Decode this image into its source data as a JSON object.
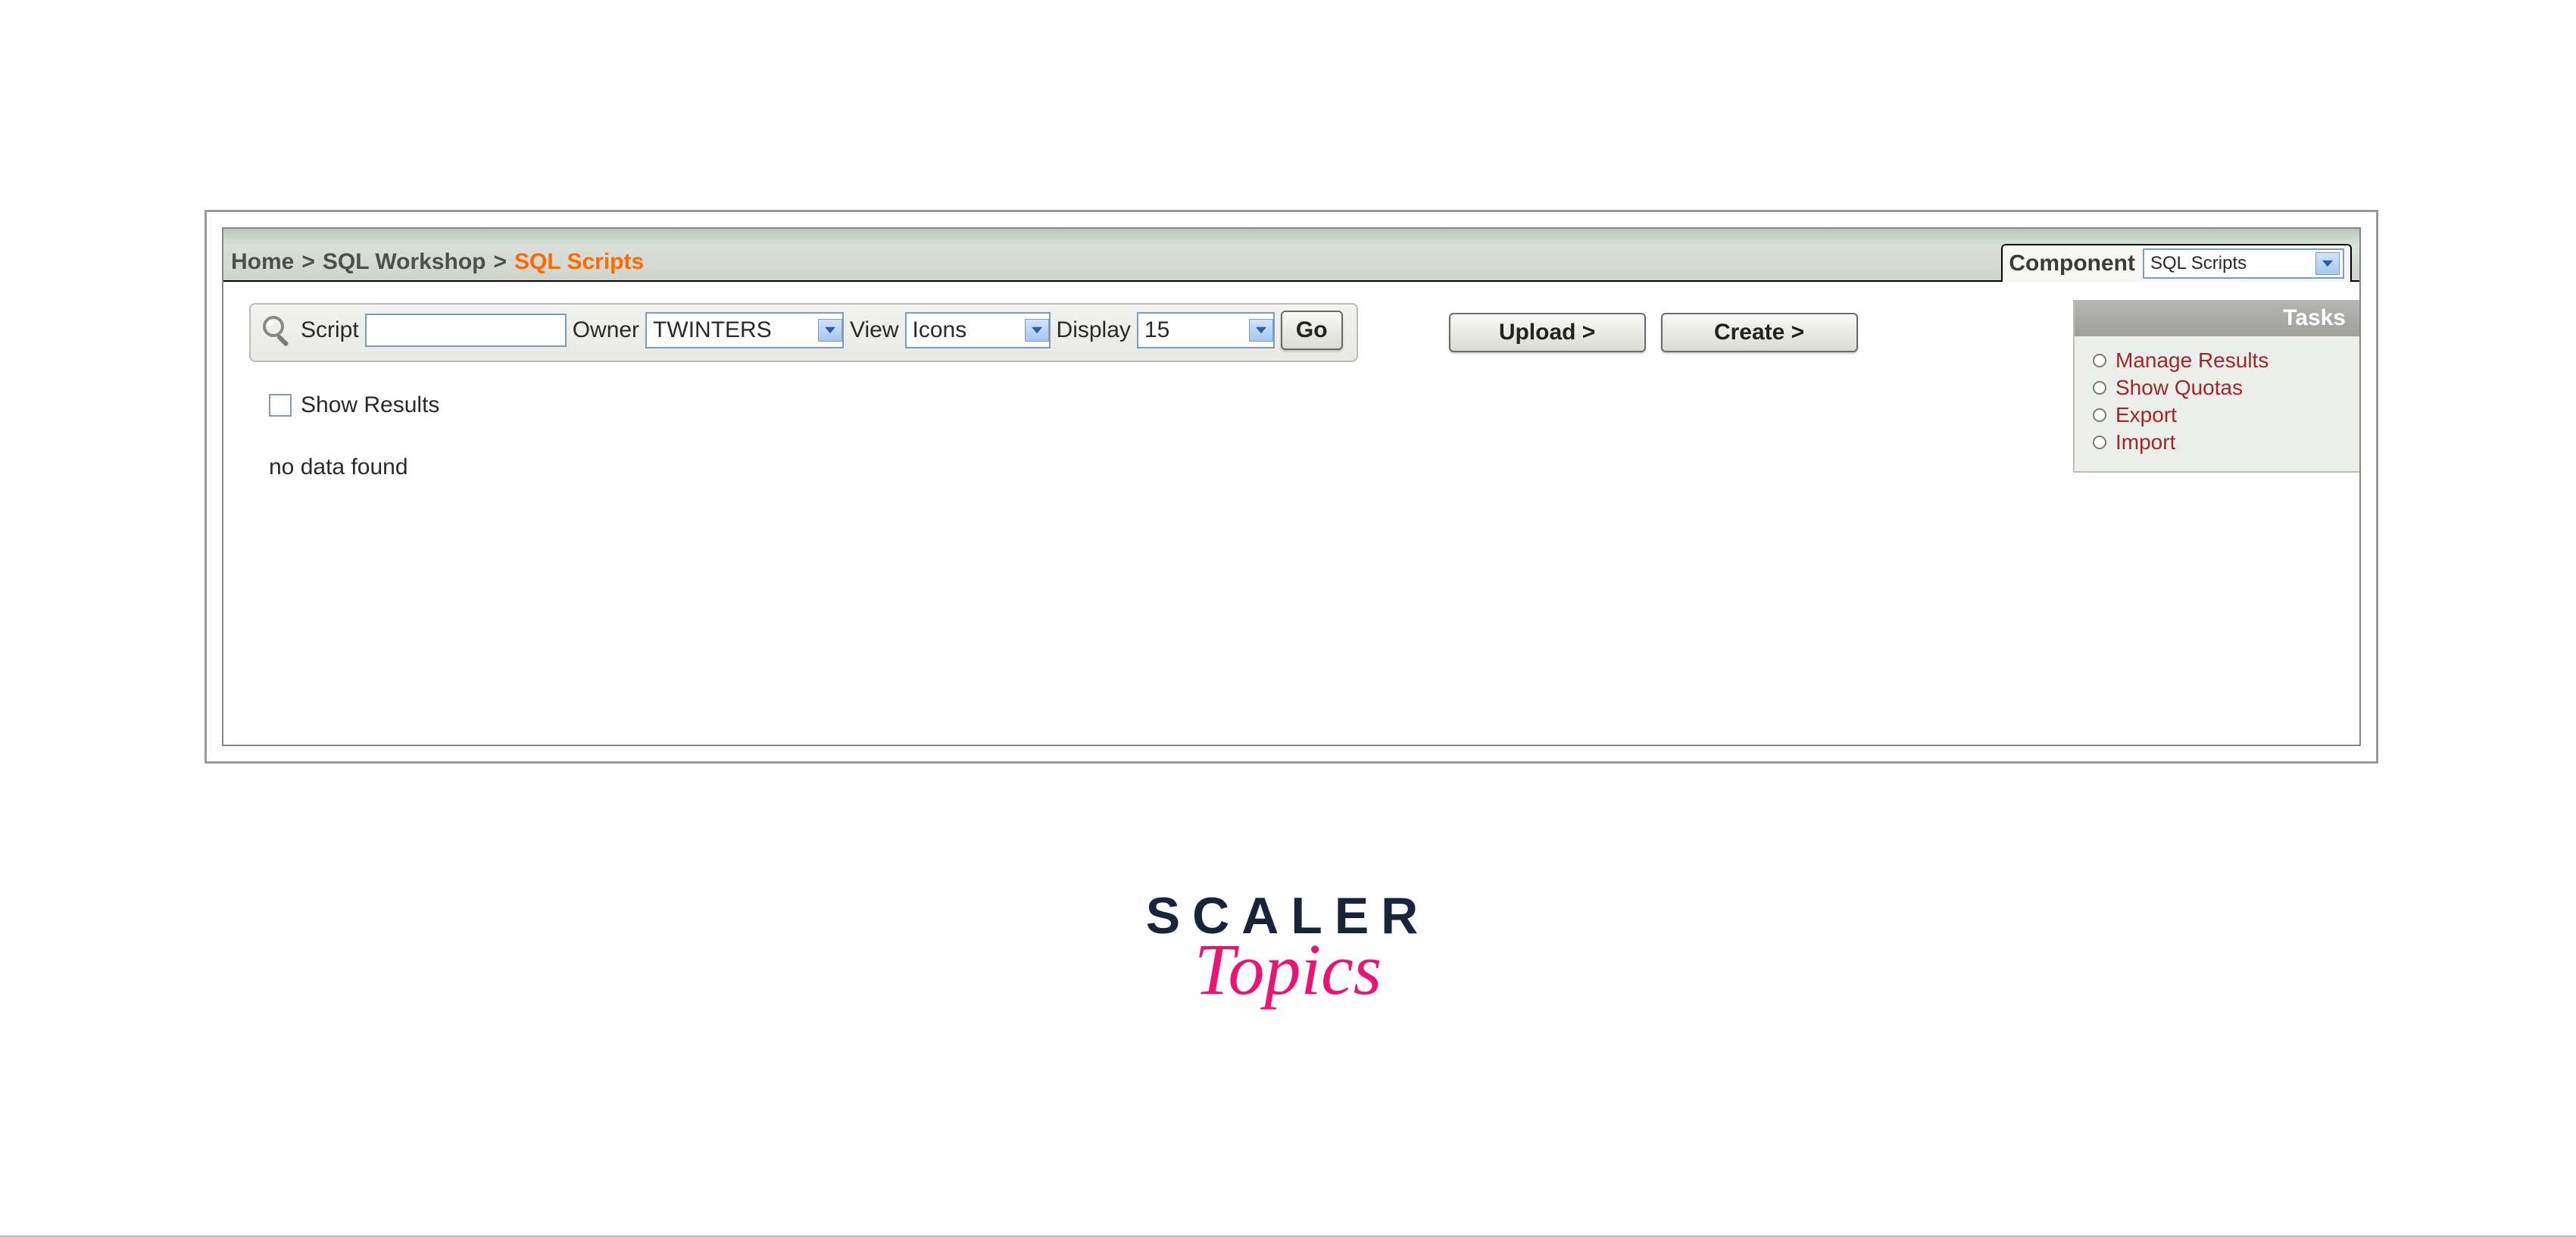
{
  "breadcrumb": {
    "home": "Home",
    "sep": ">",
    "workshop": "SQL Workshop",
    "current": "SQL Scripts"
  },
  "componentTab": {
    "label": "Component",
    "value": "SQL Scripts"
  },
  "filter": {
    "scriptLabel": "Script",
    "scriptValue": "",
    "ownerLabel": "Owner",
    "ownerValue": "TWINTERS",
    "viewLabel": "View",
    "viewValue": "Icons",
    "displayLabel": "Display",
    "displayValue": "15",
    "goLabel": "Go"
  },
  "actions": {
    "upload": "Upload >",
    "create": "Create >"
  },
  "showResultsLabel": "Show Results",
  "showResultsChecked": false,
  "noDataMsg": "no data found",
  "tasks": {
    "title": "Tasks",
    "items": [
      "Manage Results",
      "Show Quotas",
      "Export",
      "Import"
    ]
  },
  "brand": {
    "line1": "SCALER",
    "line2": "Topics"
  }
}
